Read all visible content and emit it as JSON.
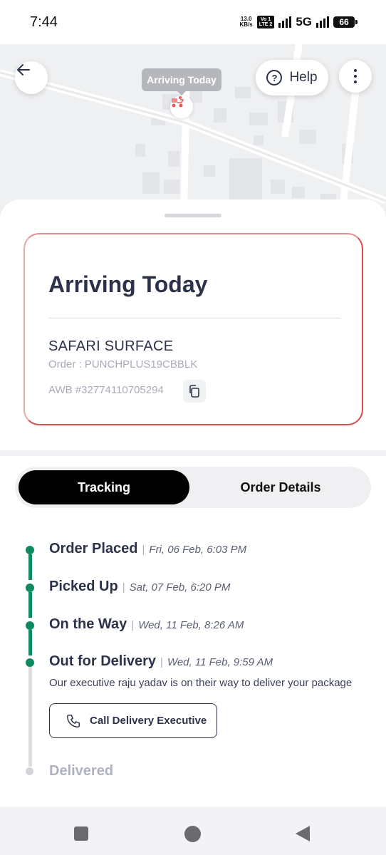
{
  "status_bar": {
    "time": "7:44",
    "net_speed_value": "13.0",
    "net_speed_unit": "KB/s",
    "volte_top": "Vo 1",
    "volte_bottom": "LTE 2",
    "network": "5G",
    "battery": "66"
  },
  "map": {
    "tooltip": "Arriving Today",
    "help_label": "Help",
    "back_icon": "arrow-left-icon",
    "menu_icon": "more-vertical-icon",
    "pin_icon": "delivery-scooter-icon"
  },
  "order_card": {
    "title": "Arriving Today",
    "courier": "SAFARI SURFACE",
    "order_label": "Order : PUNCHPLUS19CBBLK",
    "awb_label": "AWB #32774110705294",
    "copy_icon": "copy-icon"
  },
  "tabs": [
    {
      "label": "Tracking",
      "active": true
    },
    {
      "label": "Order Details",
      "active": false
    }
  ],
  "timeline": [
    {
      "name": "Order Placed",
      "time": "Fri, 06 Feb, 6:03 PM",
      "done": true
    },
    {
      "name": "Picked Up",
      "time": "Sat, 07 Feb, 6:20 PM",
      "done": true
    },
    {
      "name": "On the Way",
      "time": "Wed, 11 Feb, 8:26 AM",
      "done": true
    },
    {
      "name": "Out for Delivery",
      "time": "Wed, 11 Feb, 9:59 AM",
      "done": true
    },
    {
      "name": "Delivered",
      "time": "",
      "done": false
    }
  ],
  "separator": "|",
  "delivery_message": "Our executive raju yadav is on their way to deliver your package",
  "call_button_label": "Call Delivery Executive",
  "colors": {
    "success_green": "#0f8a5f",
    "card_border_red": "#e04a4a",
    "text_dark": "#2c3249",
    "text_muted": "#a9acb8"
  }
}
